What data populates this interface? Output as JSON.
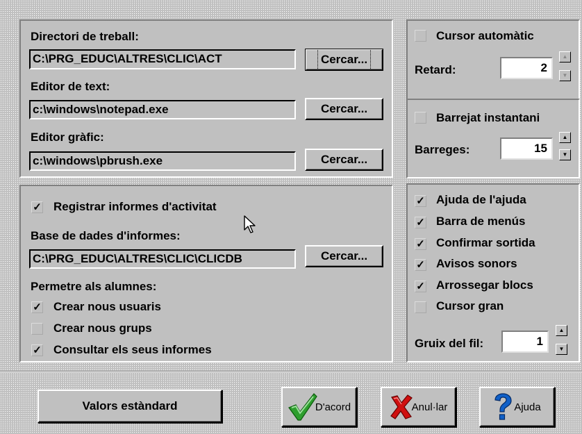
{
  "paths": {
    "work_dir_label": "Directori de treball:",
    "work_dir_value": "C:\\PRG_EDUC\\ALTRES\\CLIC\\ACT",
    "text_editor_label": "Editor de text:",
    "text_editor_value": "c:\\windows\\notepad.exe",
    "graphic_editor_label": "Editor gràfic:",
    "graphic_editor_value": "c:\\windows\\pbrush.exe",
    "browse_label": "Cercar..."
  },
  "reports": {
    "register_label": "Registrar informes d'activitat",
    "register_checked": true,
    "db_label": "Base de dades d'informes:",
    "db_value": "C:\\PRG_EDUC\\ALTRES\\CLIC\\CLICDB",
    "browse_label": "Cercar...",
    "allow_label": "Permetre als alumnes:",
    "options": [
      {
        "label": "Crear nous usuaris",
        "checked": true
      },
      {
        "label": "Crear nous grups",
        "checked": false
      },
      {
        "label": "Consultar els seus informes",
        "checked": true
      }
    ]
  },
  "cursor": {
    "auto_label": "Cursor automàtic",
    "auto_checked": false,
    "delay_label": "Retard:",
    "delay_value": "2"
  },
  "shuffle": {
    "instant_label": "Barrejat instantani",
    "instant_checked": false,
    "count_label": "Barreges:",
    "count_value": "15"
  },
  "ui_options": {
    "items": [
      {
        "label": "Ajuda de l'ajuda",
        "checked": true
      },
      {
        "label": "Barra de menús",
        "checked": true
      },
      {
        "label": "Confirmar sortida",
        "checked": true
      },
      {
        "label": "Avisos sonors",
        "checked": true
      },
      {
        "label": "Arrossegar blocs",
        "checked": true
      },
      {
        "label": "Cursor gran",
        "checked": false
      }
    ],
    "thickness_label": "Gruix del fil:",
    "thickness_value": "1"
  },
  "footer": {
    "defaults_label": "Valors estàndard",
    "ok_label": "D'acord",
    "cancel_label": "Anul·lar",
    "help_label": "Ajuda"
  },
  "check_glyph": "✓",
  "colors": {
    "face": "#c0c0c0",
    "shadow": "#808080",
    "highlight": "#ffffff",
    "ok_green": "#2e9e2e",
    "cancel_red": "#d01010",
    "help_blue": "#1060c8"
  }
}
